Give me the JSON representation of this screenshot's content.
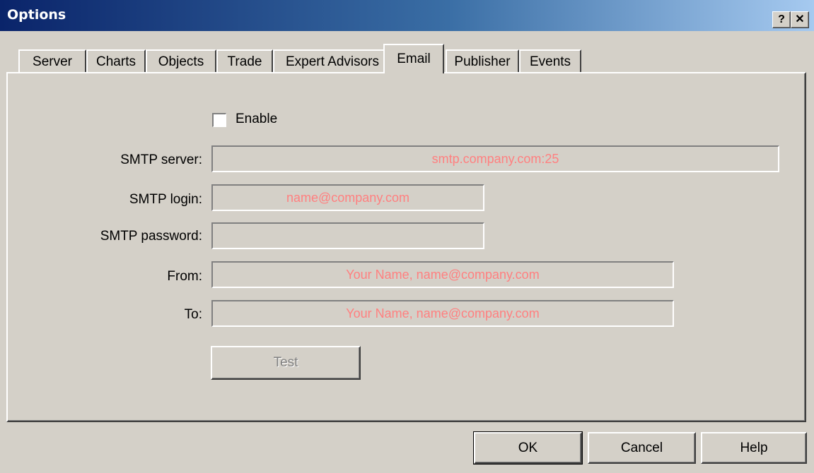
{
  "window": {
    "title": "Options",
    "help_glyph": "?",
    "close_glyph": "✕"
  },
  "tabs": [
    {
      "label": "Server"
    },
    {
      "label": "Charts"
    },
    {
      "label": "Objects"
    },
    {
      "label": "Trade"
    },
    {
      "label": "Expert Advisors"
    },
    {
      "label": "Email",
      "active": true
    },
    {
      "label": "Publisher"
    },
    {
      "label": "Events"
    }
  ],
  "email": {
    "enable_label": "Enable",
    "enable_checked": false,
    "smtp_server_label": "SMTP server:",
    "smtp_server_value": "smtp.company.com:25",
    "smtp_login_label": "SMTP login:",
    "smtp_login_value": "name@company.com",
    "smtp_password_label": "SMTP password:",
    "smtp_password_value": "",
    "from_label": "From:",
    "from_value": "Your Name, name@company.com",
    "to_label": "To:",
    "to_value": "Your Name, name@company.com",
    "test_label": "Test"
  },
  "footer": {
    "ok_label": "OK",
    "cancel_label": "Cancel",
    "help_label": "Help"
  },
  "colors": {
    "face": "#d4d0c8",
    "title_gradient_start": "#0a246a",
    "title_gradient_end": "#a6caf0",
    "sample_text": "#ff8080"
  }
}
